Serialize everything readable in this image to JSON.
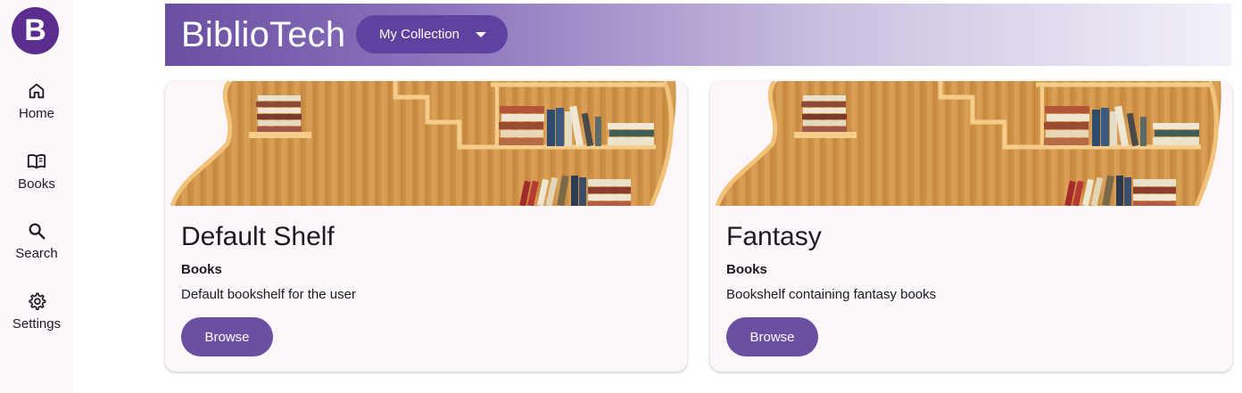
{
  "app": {
    "logo_letter": "B",
    "brand": "BiblioTech"
  },
  "nav": {
    "items": [
      {
        "label": "Home",
        "icon": "home-icon"
      },
      {
        "label": "Books",
        "icon": "book-icon"
      },
      {
        "label": "Search",
        "icon": "search-icon"
      },
      {
        "label": "Settings",
        "icon": "gear-icon"
      }
    ]
  },
  "header": {
    "collection_label": "My Collection"
  },
  "shelves": [
    {
      "title": "Default Shelf",
      "subtitle": "Books",
      "description": "Default bookshelf for the user",
      "button": "Browse"
    },
    {
      "title": "Fantasy",
      "subtitle": "Books",
      "description": "Bookshelf containing fantasy books",
      "button": "Browse"
    }
  ],
  "colors": {
    "accent": "#6a4fa3",
    "logo": "#5b2d8e",
    "rail_bg": "#fdf8fb",
    "card_bg": "#fdf7fb"
  }
}
